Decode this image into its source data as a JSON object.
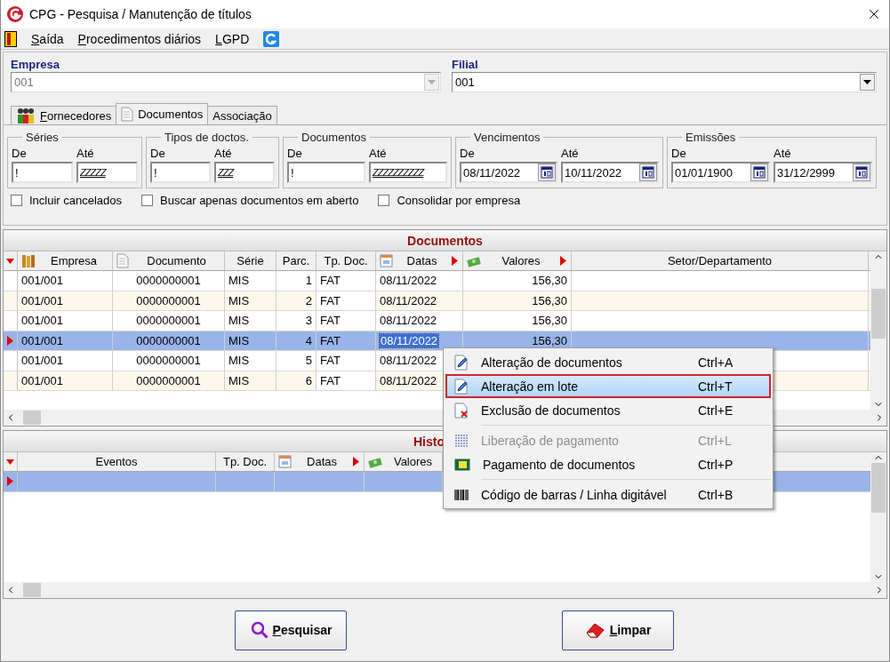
{
  "window": {
    "title": "CPG - Pesquisa / Manutenção de títulos"
  },
  "menu": [
    {
      "mnemonic": "S",
      "rest": "aída"
    },
    {
      "mnemonic": "P",
      "rest": "rocedimentos diários"
    },
    {
      "mnemonic": "L",
      "rest": "GPD"
    }
  ],
  "empresa": {
    "label": "Empresa",
    "value": "001",
    "disabled": true
  },
  "filial": {
    "label": "Filial",
    "value": "001",
    "disabled": false
  },
  "tabs": [
    {
      "mnemonic": "F",
      "rest": "ornecedores",
      "selected": false
    },
    {
      "rest": "Documentos",
      "selected": true
    },
    {
      "rest": "Associação",
      "selected": false
    }
  ],
  "filters": [
    {
      "kind": "text",
      "title": "Séries",
      "from_label": "De",
      "to_label": "Até",
      "from": "!",
      "to": "ZZZZZ"
    },
    {
      "kind": "text",
      "title": "Tipos de doctos.",
      "from_label": "De",
      "to_label": "Até",
      "from": "!",
      "to": "ZZZ"
    },
    {
      "kind": "text",
      "title": "Documentos",
      "from_label": "De",
      "to_label": "Até",
      "from": "!",
      "to": "ZZZZZZZZZZ"
    },
    {
      "kind": "date",
      "title": "Vencimentos",
      "from_label": "De",
      "to_label": "Até",
      "from": "08/11/2022",
      "to": "10/11/2022"
    },
    {
      "kind": "date",
      "title": "Emissões",
      "from_label": "De",
      "to_label": "Até",
      "from": "01/01/1900",
      "to": "31/12/2999"
    }
  ],
  "options": [
    {
      "label": "Incluir cancelados",
      "checked": false
    },
    {
      "label": "Buscar apenas documentos em aberto",
      "checked": false
    },
    {
      "label": "Consolidar por empresa",
      "checked": false
    }
  ],
  "documents": {
    "title": "Documentos",
    "columns": [
      {
        "label": "Empresa",
        "sort_marker": false
      },
      {
        "label": "Documento",
        "sort_marker": false
      },
      {
        "label": "Série",
        "sort_marker": false
      },
      {
        "label": "Parc.",
        "sort_marker": false
      },
      {
        "label": "Tp. Doc.",
        "sort_marker": false
      },
      {
        "label": "Datas",
        "sort_marker": true
      },
      {
        "label": "Valores",
        "sort_marker": true
      },
      {
        "label": "Setor/Departamento",
        "sort_marker": false
      }
    ],
    "rows": [
      {
        "selected": false,
        "cells": [
          "001/001",
          "0000000001",
          "MIS",
          "1",
          "FAT",
          "08/11/2022",
          "156,30"
        ]
      },
      {
        "selected": false,
        "cells": [
          "001/001",
          "0000000001",
          "MIS",
          "2",
          "FAT",
          "08/11/2022",
          "156,30"
        ]
      },
      {
        "selected": false,
        "cells": [
          "001/001",
          "0000000001",
          "MIS",
          "3",
          "FAT",
          "08/11/2022",
          "156,30"
        ]
      },
      {
        "selected": true,
        "cells": [
          "001/001",
          "0000000001",
          "MIS",
          "4",
          "FAT",
          "08/11/2022",
          "156,30"
        ]
      },
      {
        "selected": false,
        "cells": [
          "001/001",
          "0000000001",
          "MIS",
          "5",
          "FAT",
          "08/11/2022"
        ]
      },
      {
        "selected": false,
        "cells": [
          "001/001",
          "0000000001",
          "MIS",
          "6",
          "FAT",
          "08/11/2022"
        ]
      }
    ]
  },
  "history": {
    "title": "Histo",
    "columns": [
      {
        "label": "Eventos",
        "sort_marker": false
      },
      {
        "label": "Tp. Doc.",
        "sort_marker": false
      },
      {
        "label": "Datas",
        "sort_marker": true
      },
      {
        "label": "Valores",
        "sort_marker": false
      }
    ],
    "rows": [
      {
        "selected": true,
        "cells": []
      }
    ]
  },
  "context_menu": [
    {
      "kind": "item",
      "label": "Alteração de documentos",
      "shortcut": "Ctrl+A",
      "disabled": false,
      "selected": false
    },
    {
      "kind": "item",
      "label": "Alteração em lote",
      "shortcut": "Ctrl+T",
      "disabled": false,
      "selected": true
    },
    {
      "kind": "item",
      "label": "Exclusão de documentos",
      "shortcut": "Ctrl+E",
      "disabled": false,
      "selected": false
    },
    {
      "kind": "separator"
    },
    {
      "kind": "item",
      "label": "Liberação de pagamento",
      "shortcut": "Ctrl+L",
      "disabled": true,
      "selected": false
    },
    {
      "kind": "item",
      "label": "Pagamento de documentos",
      "shortcut": "Ctrl+P",
      "disabled": false,
      "selected": false
    },
    {
      "kind": "separator"
    },
    {
      "kind": "item",
      "label": "Código de barras / Linha digitável",
      "shortcut": "Ctrl+B",
      "disabled": false,
      "selected": false
    }
  ],
  "buttons": [
    {
      "mnemonic": "P",
      "rest": "esquisar"
    },
    {
      "mnemonic": "L",
      "rest": "impar"
    }
  ]
}
